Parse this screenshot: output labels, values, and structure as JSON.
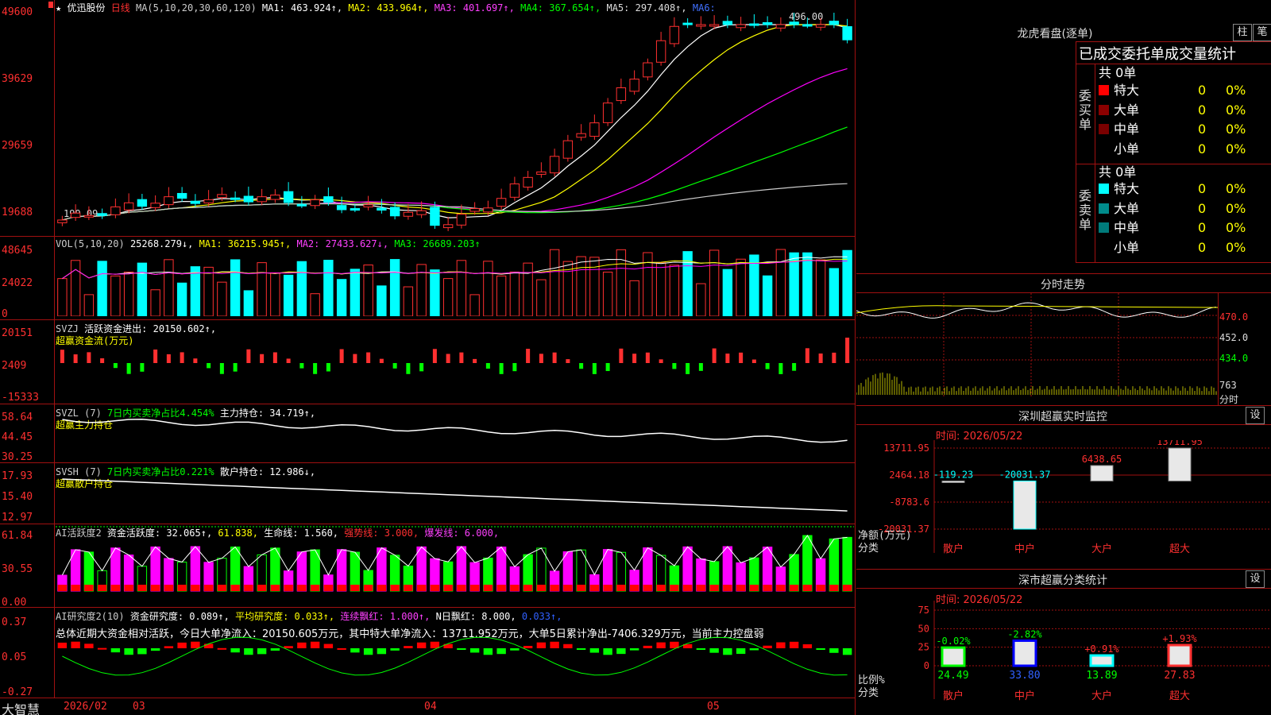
{
  "colors": {
    "up": "#ff3030",
    "down": "#00ffff",
    "ma1": "#ffffff",
    "ma2": "#ffff00",
    "ma3": "#ff00ff",
    "ma4": "#00ff00",
    "ma5": "#cccccc",
    "ma6": "#3060ff",
    "grid": "#a01010"
  },
  "kline": {
    "star": "★",
    "name": "优迅股份",
    "period": "日线",
    "ma_label": "MA(5,10,20,30,60,120)",
    "ma1": "MA1: 463.924↑,",
    "ma2": "MA2: 433.964↑,",
    "ma3": "MA3: 401.697↑,",
    "ma4": "MA4: 367.654↑,",
    "ma5": "MA5: 297.408↑,",
    "ma6": "MA6:",
    "y_labels": [
      "49600",
      "39629",
      "29659",
      "19688"
    ],
    "high_label": "496.00",
    "low_label": "199.09"
  },
  "vol": {
    "label": "VOL(5,10,20)",
    "value": "25268.279↓,",
    "ma1": "MA1: 36215.945↑,",
    "ma2": "MA2: 27433.627↓,",
    "ma3": "MA3: 26689.203↑",
    "y_labels": [
      "48645",
      "24022",
      "0"
    ]
  },
  "svzj": {
    "label": "SVZJ",
    "text": "活跃资金进出: 20150.602↑,",
    "sub": "超赢资金流(万元)",
    "y_labels": [
      "20151",
      "2409",
      "-15333"
    ]
  },
  "svzl": {
    "label": "SVZL (7)",
    "text1": "7日内买卖净占比4.454%",
    "text2": "主力持仓: 34.719↑,",
    "sub": "超赢主力持仓",
    "y_labels": [
      "58.64",
      "44.45",
      "30.25"
    ]
  },
  "svsh": {
    "label": "SVSH (7)",
    "text1": "7日内买卖净占比0.221%",
    "text2": "散户持仓: 12.986↓,",
    "sub": "超赢散户持仓",
    "y_labels": [
      "17.93",
      "15.40",
      "12.97"
    ]
  },
  "ai1": {
    "label": "AI活跃度2",
    "t1": "资金活跃度: 32.065↑,",
    "t2": "61.838,",
    "t3": "生命线: 1.560,",
    "t4": "强势线: 3.000,",
    "t5": "爆发线: 6.000,",
    "y_labels": [
      "61.84",
      "30.55",
      "0.00"
    ]
  },
  "ai2": {
    "label": "AI研究度2(10)",
    "t1": "资金研究度: 0.089↑,",
    "t2": "平均研究度: 0.033↑,",
    "t3": "连续飘红: 1.000↑,",
    "t4": "N日飘红: 8.000,",
    "t5": "0.033↑,",
    "summary": "总体近期大资金相对活跃，今日大单净流入：20150.605万元，其中特大单净流入：13711.952万元，大单5日累计净出-7406.329万元，当前主力控盘弱",
    "y_labels": [
      "0.37",
      "0.05",
      "-0.27"
    ]
  },
  "bottom": {
    "brand": "大智慧",
    "dates": [
      "2026/02",
      "03",
      "04",
      "05"
    ]
  },
  "right": {
    "lhb_title": "龙虎看盘(逐单)",
    "btn1": "柱",
    "btn2": "笔",
    "tabs": "已成交委托单成交量统计",
    "buy": {
      "side": "委买单",
      "total": "共 0单",
      "rows": [
        {
          "label": "特大",
          "count": "0",
          "pct": "0%",
          "color": "#ff0000"
        },
        {
          "label": "大单",
          "count": "0",
          "pct": "0%",
          "color": "#8b0000"
        },
        {
          "label": "中单",
          "count": "0",
          "pct": "0%",
          "color": "#7a0000"
        },
        {
          "label": "小单",
          "count": "0",
          "pct": "0%",
          "color": "#000000"
        }
      ]
    },
    "sell": {
      "side": "委卖单",
      "total": "共 0单",
      "rows": [
        {
          "label": "特大",
          "count": "0",
          "pct": "0%",
          "color": "#00ffff"
        },
        {
          "label": "大单",
          "count": "0",
          "pct": "0%",
          "color": "#008b8b"
        },
        {
          "label": "中单",
          "count": "0",
          "pct": "0%",
          "color": "#007a7a"
        },
        {
          "label": "小单",
          "count": "0",
          "pct": "0%",
          "color": "#000000"
        }
      ]
    },
    "fenshi": {
      "title": "分时走势",
      "y_labels": [
        "470.0",
        "452.0",
        "434.0"
      ],
      "vol_label": "763",
      "unit": "分时"
    },
    "sz_monitor": {
      "title": "深圳超赢实时监控",
      "set": "设",
      "time": "时间: 2026/05/22",
      "y_labels": [
        "13711.95",
        "2464.18",
        "-8783.6",
        "-20031.37"
      ],
      "ylabel": "净额(万元)",
      "xlabel": "分类",
      "cats": [
        "散户",
        "中户",
        "大户",
        "超大"
      ],
      "vals": [
        "-119.23",
        "-20031.37",
        "6438.65",
        "13711.95"
      ]
    },
    "sz_class": {
      "title": "深市超赢分类统计",
      "set": "设",
      "time": "时间: 2026/05/22",
      "y_labels": [
        "75",
        "50",
        "25",
        "0"
      ],
      "ylabel": "比例%",
      "xlabel": "分类",
      "cats": [
        "散户",
        "中户",
        "大户",
        "超大"
      ],
      "vals": [
        "24.49",
        "33.80",
        "13.89",
        "27.83"
      ],
      "chg": [
        "-0.02%",
        "-2.82%",
        "+0.91%",
        "+1.93%"
      ]
    }
  },
  "chart_data": {
    "type": "bar",
    "title": "深圳超赢实时监控",
    "categories": [
      "散户",
      "中户",
      "大户",
      "超大"
    ],
    "values": [
      -119.23,
      -20031.37,
      6438.65,
      13711.95
    ]
  }
}
